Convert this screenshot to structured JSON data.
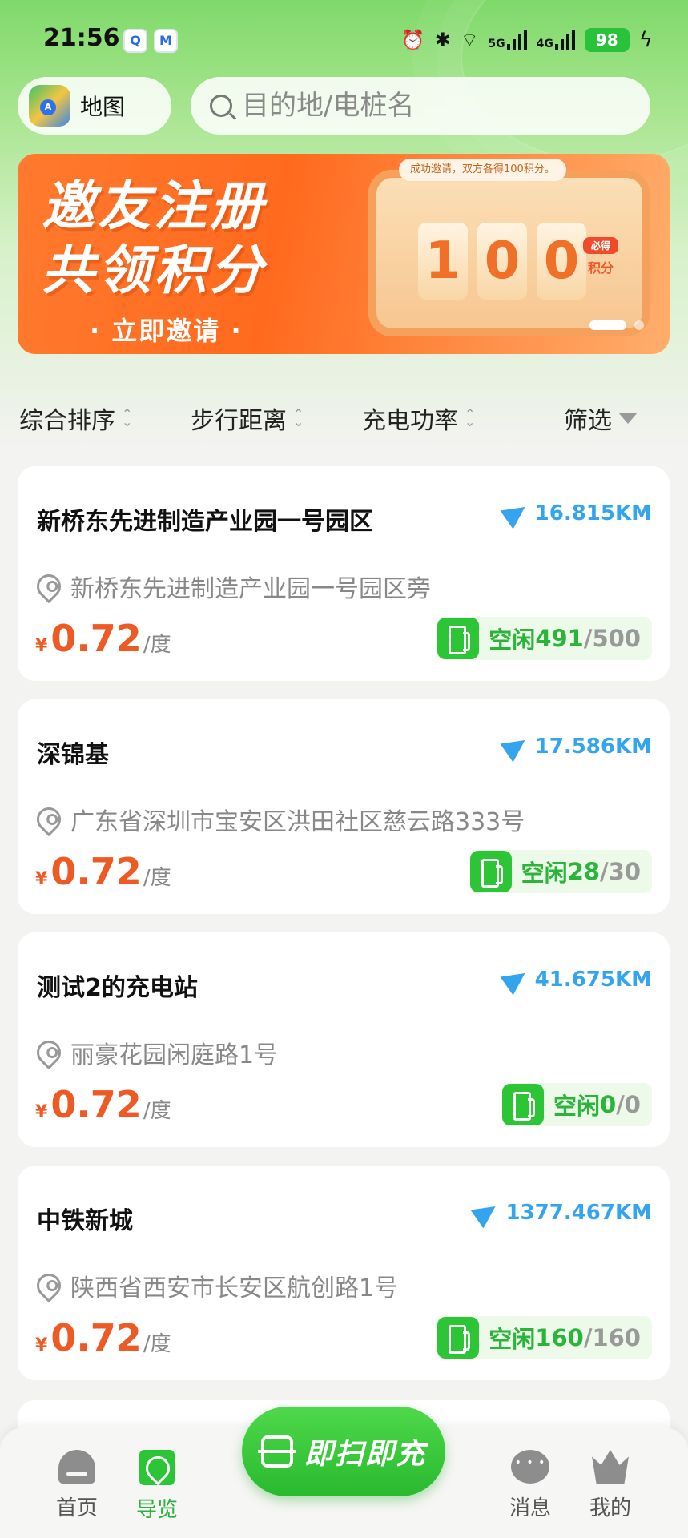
{
  "status_bar": {
    "time": "21:56",
    "notif1": "Q",
    "notif2": "M",
    "signal1": "5G",
    "signal2": "4G",
    "battery": "98"
  },
  "search": {
    "map_label": "地图",
    "placeholder": "目的地/电桩名"
  },
  "banner": {
    "title_line1": "邀友注册",
    "title_line2": "共领积分",
    "cta": "· 立即邀请 ·",
    "caption": "成功邀请，双方各得100积分。",
    "digits": [
      "1",
      "0",
      "0"
    ],
    "badge_top": "必得",
    "badge_bottom": "积分"
  },
  "filters": {
    "sort": "综合排序",
    "distance": "步行距离",
    "power": "充电功率",
    "filter": "筛选"
  },
  "stations": [
    {
      "name": "新桥东先进制造产业园一号园区",
      "distance": "16.815KM",
      "address": "新桥东先进制造产业园一号园区旁",
      "currency": "¥",
      "price": "0.72",
      "unit": "/度",
      "avail_label": "空闲",
      "free": "491",
      "total": "/500"
    },
    {
      "name": "深锦基",
      "distance": "17.586KM",
      "address": "广东省深圳市宝安区洪田社区慈云路333号",
      "currency": "¥",
      "price": "0.72",
      "unit": "/度",
      "avail_label": "空闲",
      "free": "28",
      "total": "/30"
    },
    {
      "name": "测试2的充电站",
      "distance": "41.675KM",
      "address": "丽豪花园闲庭路1号",
      "currency": "¥",
      "price": "0.72",
      "unit": "/度",
      "avail_label": "空闲",
      "free": "0",
      "total": "/0"
    },
    {
      "name": "中铁新城",
      "distance": "1377.467KM",
      "address": "陕西省西安市长安区航创路1号",
      "currency": "¥",
      "price": "0.72",
      "unit": "/度",
      "avail_label": "空闲",
      "free": "160",
      "total": "/160"
    }
  ],
  "tabbar": {
    "home": "首页",
    "guide": "导览",
    "scan": "即扫即充",
    "messages": "消息",
    "mine": "我的"
  },
  "colors": {
    "brand_green": "#2cc536",
    "price_orange": "#ee5a24",
    "distance_blue": "#35a4ee"
  }
}
